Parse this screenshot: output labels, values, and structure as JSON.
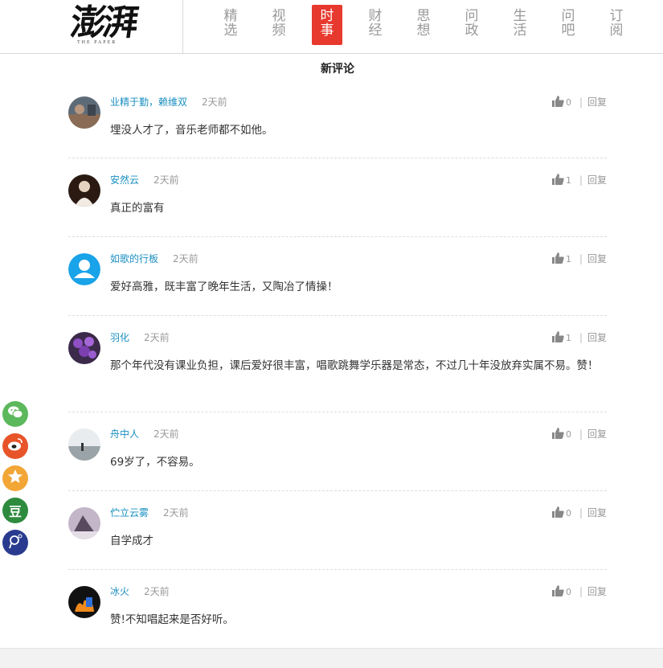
{
  "logo": {
    "cn": "澎湃",
    "en": "THE PAPER"
  },
  "nav": [
    {
      "label_top": "精",
      "label_bottom": "选",
      "active": false
    },
    {
      "label_top": "视",
      "label_bottom": "频",
      "active": false
    },
    {
      "label_top": "时",
      "label_bottom": "事",
      "active": true
    },
    {
      "label_top": "财",
      "label_bottom": "经",
      "active": false
    },
    {
      "label_top": "思",
      "label_bottom": "想",
      "active": false
    },
    {
      "label_top": "问",
      "label_bottom": "政",
      "active": false
    },
    {
      "label_top": "生",
      "label_bottom": "活",
      "active": false
    },
    {
      "label_top": "问",
      "label_bottom": "吧",
      "active": false
    },
    {
      "label_top": "订",
      "label_bottom": "阅",
      "active": false
    }
  ],
  "section_title": "新评论",
  "reply_label": "回复",
  "separator": "|",
  "comments": [
    {
      "user": "业精于勤，赖维双",
      "time": "2天前",
      "likes": "0",
      "text": "埋没人才了，音乐老师都不如他。",
      "avatar": "photo-dark"
    },
    {
      "user": "安然云",
      "time": "2天前",
      "likes": "1",
      "text": "真正的富有",
      "avatar": "photo-woman"
    },
    {
      "user": "如歌的行板",
      "time": "2天前",
      "likes": "1",
      "text": "爱好高雅，既丰富了晚年生活，又陶冶了情操！",
      "avatar": "default-user"
    },
    {
      "user": "羽化",
      "time": "2天前",
      "likes": "1",
      "text": "那个年代没有课业负担，课后爱好很丰富，唱歌跳舞学乐器是常态，不过几十年没放弃实属不易。赞！",
      "avatar": "photo-flowers"
    },
    {
      "user": "舟中人",
      "time": "2天前",
      "likes": "0",
      "text": "69岁了，不容易。",
      "avatar": "photo-fog"
    },
    {
      "user": "伫立云雾",
      "time": "2天前",
      "likes": "0",
      "text": "自学成才",
      "avatar": "photo-mountain"
    },
    {
      "user": "冰火",
      "time": "2天前",
      "likes": "0",
      "text": "赞!不知唱起来是否好听。",
      "avatar": "photo-fire"
    }
  ],
  "share": [
    {
      "name": "wechat-icon",
      "color": "#5cb85c",
      "glyph": ""
    },
    {
      "name": "weibo-icon",
      "color": "#e8542a",
      "glyph": ""
    },
    {
      "name": "qzone-icon",
      "color": "#f2a636",
      "glyph": ""
    },
    {
      "name": "douban-icon",
      "color": "#2e8b3e",
      "glyph": "豆"
    },
    {
      "name": "pengpai-icon",
      "color": "#2a3b8f",
      "glyph": ""
    }
  ],
  "colors": {
    "accent": "#e8392e",
    "username": "#1a8fc0"
  }
}
